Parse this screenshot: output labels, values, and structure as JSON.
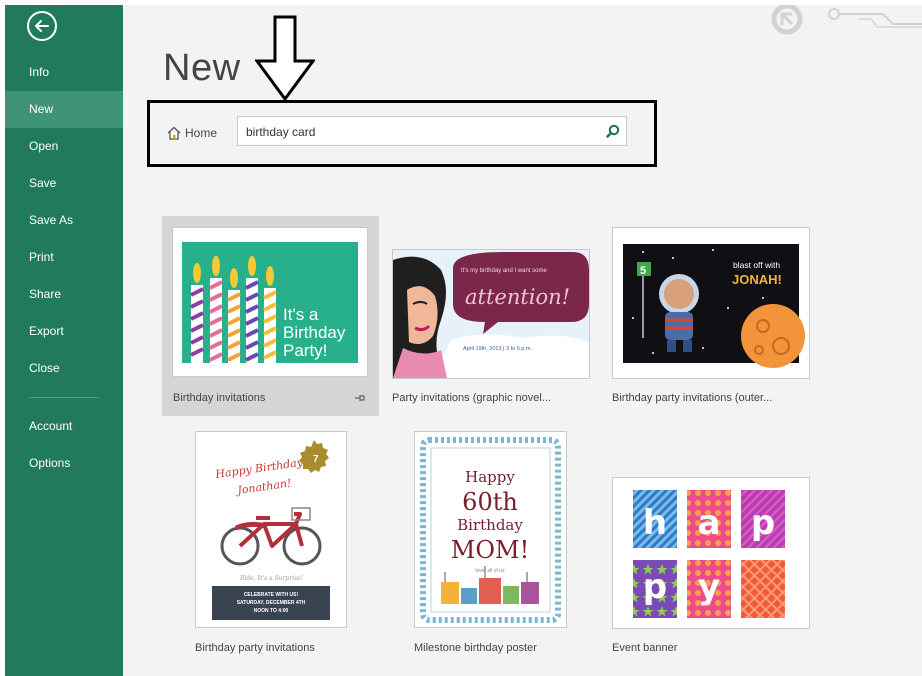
{
  "sidebar": {
    "back_icon": "back-arrow-icon",
    "items": [
      {
        "label": "Info"
      },
      {
        "label": "New"
      },
      {
        "label": "Open"
      },
      {
        "label": "Save"
      },
      {
        "label": "Save As"
      },
      {
        "label": "Print"
      },
      {
        "label": "Share"
      },
      {
        "label": "Export"
      },
      {
        "label": "Close"
      },
      {
        "label": "Account"
      },
      {
        "label": "Options"
      }
    ],
    "active": "New",
    "color": "#217a5e",
    "active_color": "#3f9478"
  },
  "header": {
    "title": "New"
  },
  "search": {
    "home_label": "Home",
    "query": "birthday card"
  },
  "templates": [
    {
      "label": "Birthday invitations",
      "text_lines": [
        "It's a",
        "Birthday",
        "Party!"
      ],
      "selected": true
    },
    {
      "label": "Party invitations (graphic novel...",
      "text_top": "It's my birthday and I want some",
      "text_big": "attention!",
      "text_small": "April 19th, 2013 | 3 to 5 p.m."
    },
    {
      "label": "Birthday party invitations (outer...",
      "text_top": "blast off with",
      "text_big": "JONAH!",
      "badge": "5"
    },
    {
      "label": "Birthday party invitations",
      "text_top": "Happy Birthday",
      "text_name": "Jonathan!",
      "badge": "7",
      "text_mid": "Ride, It's a Surprise!",
      "footer_lines": [
        "CELEBRATE WITH US!",
        "SATURDAY, DECEMBER 4TH",
        "NOON TO 4:00"
      ]
    },
    {
      "label": "Milestone birthday poster",
      "text_lines": [
        "Happy",
        "60th",
        "Birthday",
        "MOM!"
      ],
      "text_small": "love, all of us"
    },
    {
      "label": "Event banner",
      "letters": [
        "h",
        "a",
        "p",
        "p",
        "y"
      ]
    }
  ]
}
